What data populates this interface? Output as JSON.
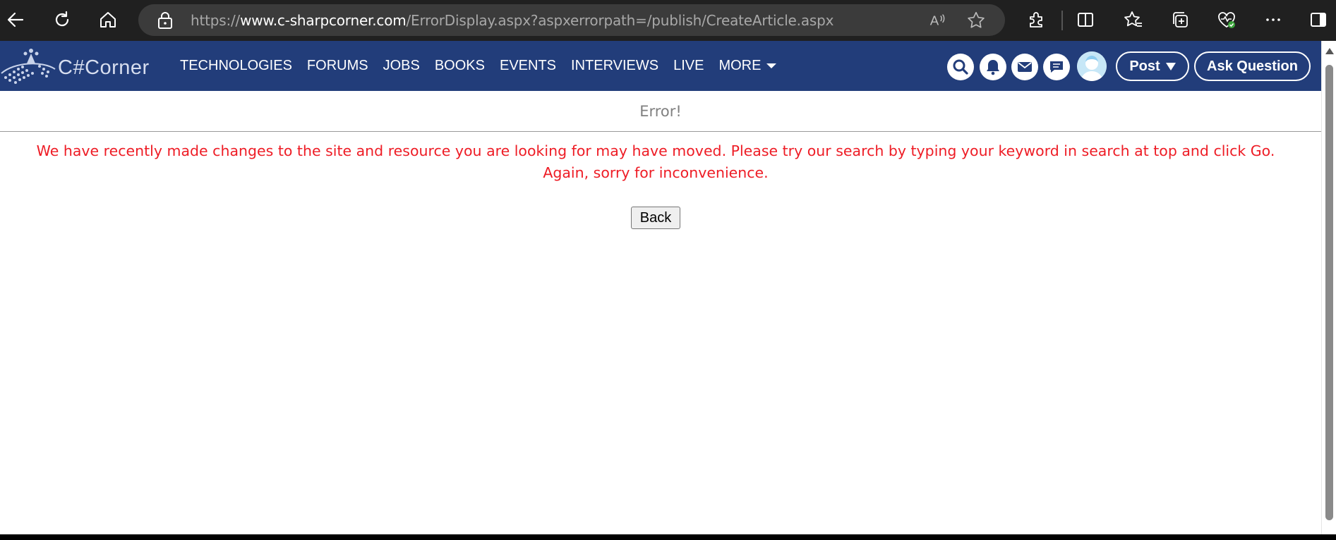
{
  "browser": {
    "url_prefix": "https://",
    "url_host": "www.c-sharpcorner.com",
    "url_path": "/ErrorDisplay.aspx?aspxerrorpath=/publish/CreateArticle.aspx",
    "icons": [
      "back-arrow-icon",
      "refresh-icon",
      "home-icon",
      "lock-icon",
      "read-aloud-icon",
      "favorite-star-icon",
      "extensions-icon",
      "split-screen-icon",
      "favorites-icon",
      "collections-icon",
      "browser-essentials-icon",
      "more-icon",
      "sidebar-icon"
    ]
  },
  "site": {
    "logo_text": "C#Corner",
    "nav": [
      "TECHNOLOGIES",
      "FORUMS",
      "JOBS",
      "BOOKS",
      "EVENTS",
      "INTERVIEWS",
      "LIVE",
      "MORE"
    ],
    "post_label": "Post",
    "ask_label": "Ask Question",
    "header_color": "#223d7a"
  },
  "content": {
    "error_title": "Error!",
    "message_line1": "We have recently made changes to the site and resource you are looking for may have moved. Please try our search by typing your keyword in search at top and click Go.",
    "message_line2": "Again, sorry for inconvenience.",
    "back_label": "Back",
    "message_color": "#ee1c25"
  }
}
